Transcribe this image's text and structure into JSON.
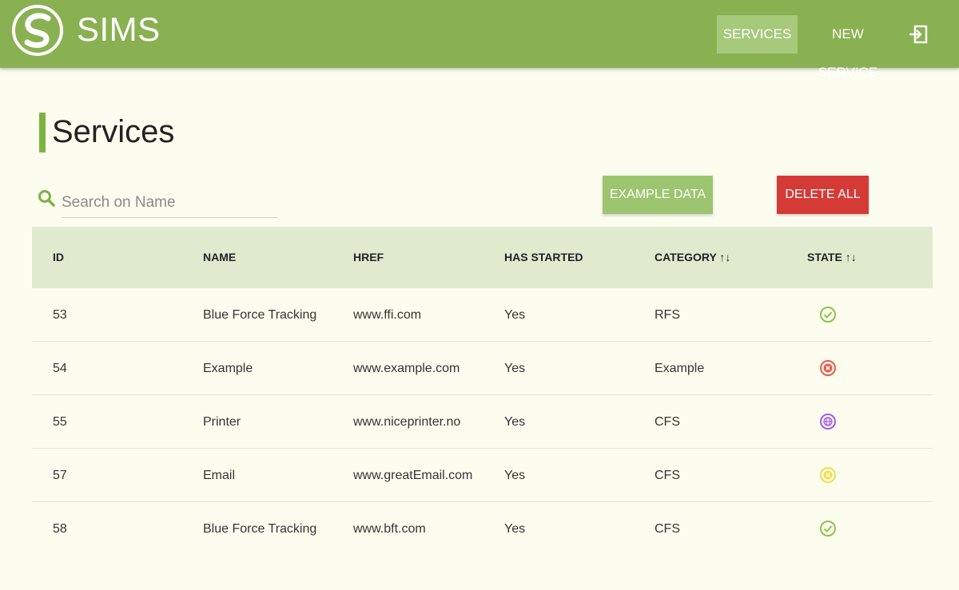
{
  "header": {
    "brand": "SIMS",
    "logo_icon": "sims-logo-icon",
    "nav": {
      "services_label": "SERVICES",
      "new_service_label": "NEW SERVICE",
      "logout_icon": "logout-icon"
    }
  },
  "page": {
    "title": "Services"
  },
  "search": {
    "placeholder": "Search on Name",
    "value": ""
  },
  "actions": {
    "example_label": "EXAMPLE DATA",
    "delete_label": "DELETE ALL"
  },
  "table": {
    "headers": {
      "id": "ID",
      "name": "NAME",
      "href": "HREF",
      "has_started": "HAS STARTED",
      "category": "CATEGORY ↑↓",
      "state": "STATE ↑↓"
    },
    "rows": [
      {
        "id": "53",
        "name": "Blue Force Tracking",
        "href": "www.ffi.com",
        "has_started": "Yes",
        "category": "RFS",
        "state_icon": "check-circle-icon"
      },
      {
        "id": "54",
        "name": "Example",
        "href": "www.example.com",
        "has_started": "Yes",
        "category": "Example",
        "state_icon": "x-circle-icon"
      },
      {
        "id": "55",
        "name": "Printer",
        "href": "www.niceprinter.no",
        "has_started": "Yes",
        "category": "CFS",
        "state_icon": "globe-circle-icon"
      },
      {
        "id": "57",
        "name": "Email",
        "href": "www.greatEmail.com",
        "has_started": "Yes",
        "category": "CFS",
        "state_icon": "pause-circle-icon"
      },
      {
        "id": "58",
        "name": "Blue Force Tracking",
        "href": "www.bft.com",
        "has_started": "Yes",
        "category": "CFS",
        "state_icon": "check-circle-icon"
      }
    ]
  },
  "colors": {
    "header_bg": "#89b152",
    "state_ok": "#8bc34a",
    "state_error": "#e85a4f",
    "state_globe": "#a05ce8",
    "state_paused": "#f0de4a",
    "delete_bg": "#d63a36"
  }
}
